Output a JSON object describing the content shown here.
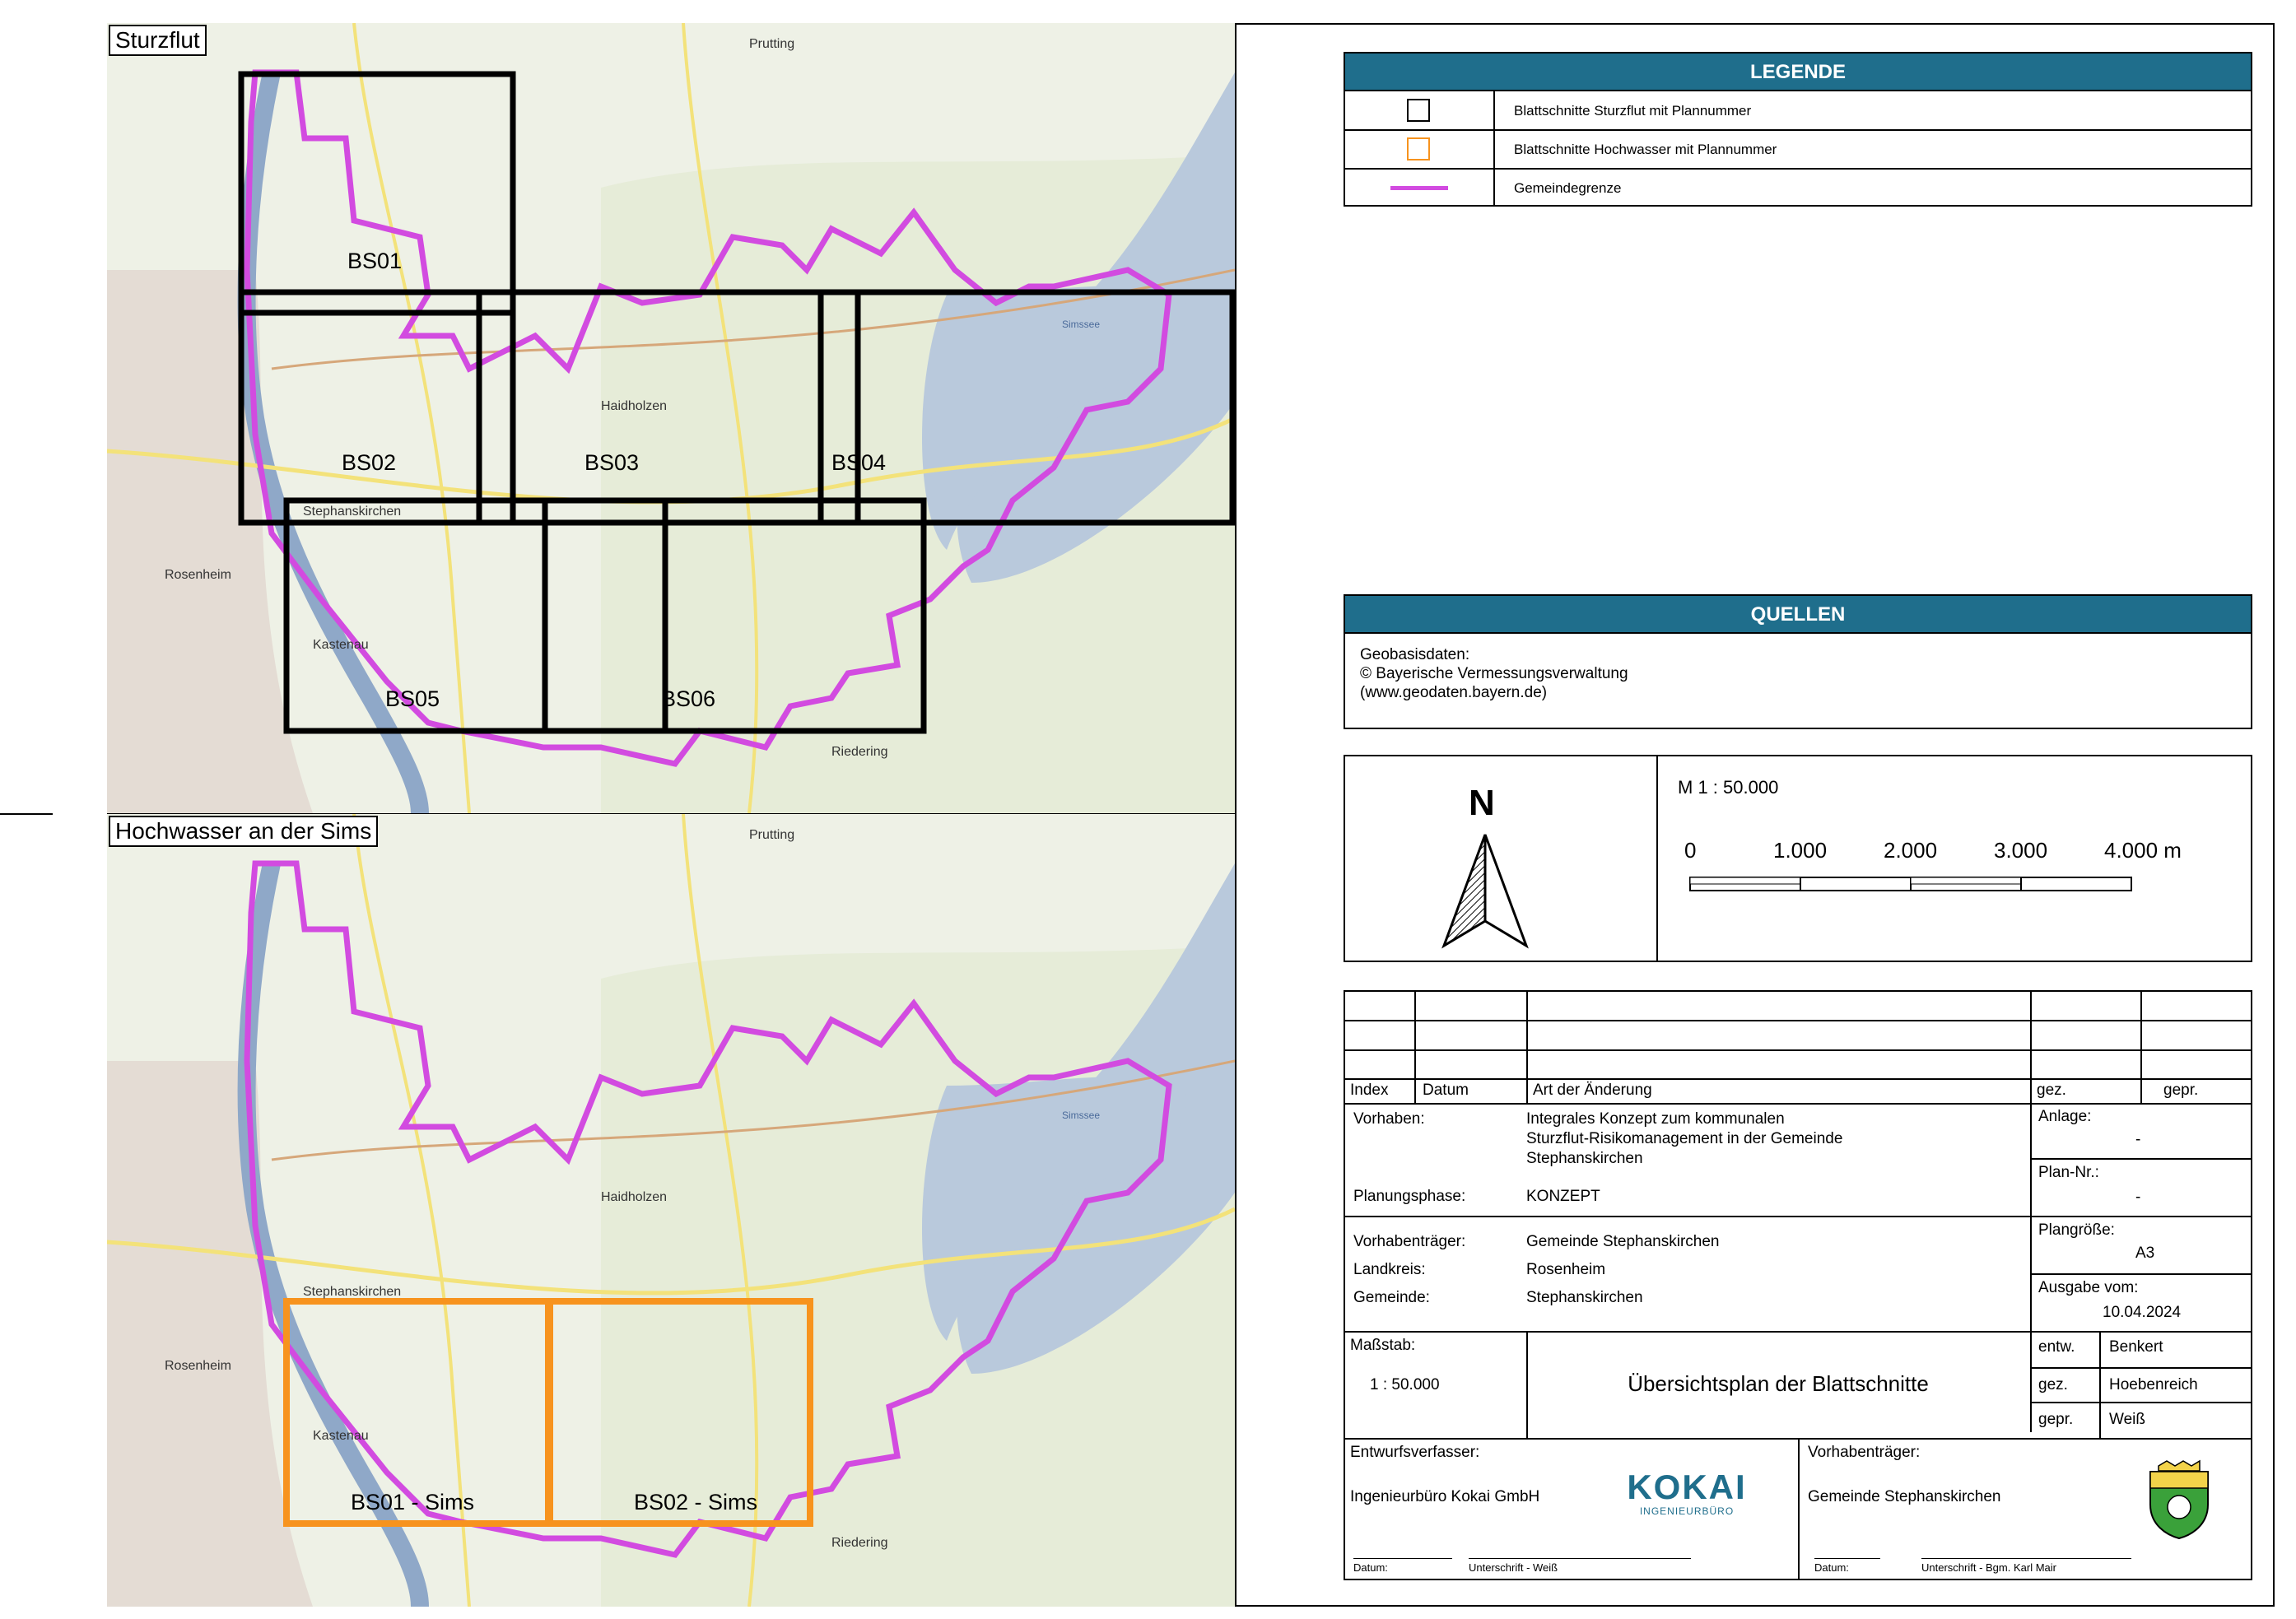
{
  "maps": {
    "top": {
      "label": "Sturzflut",
      "sheets": [
        {
          "name": "BS01"
        },
        {
          "name": "BS02"
        },
        {
          "name": "BS03"
        },
        {
          "name": "BS04"
        },
        {
          "name": "BS05"
        },
        {
          "name": "BS06"
        }
      ],
      "places": [
        "Prutting",
        "Rosenheim",
        "Kastenau",
        "Riedering",
        "Stephanskirchen",
        "Haidholzen",
        "Simssee"
      ]
    },
    "bottom": {
      "label": "Hochwasser an der Sims",
      "sheets": [
        {
          "name": "BS01 - Sims"
        },
        {
          "name": "BS02 - Sims"
        }
      ],
      "places": [
        "Prutting",
        "Rosenheim",
        "Kastenau",
        "Riedering",
        "Stephanskirchen",
        "Haidholzen",
        "Simssee"
      ]
    }
  },
  "legend": {
    "title": "LEGENDE",
    "items": [
      {
        "symbol": "black-square",
        "label": "Blattschnitte Sturzflut mit Plannummer"
      },
      {
        "symbol": "orange-square",
        "label": "Blattschnitte Hochwasser mit Plannummer"
      },
      {
        "symbol": "magenta-line",
        "label": "Gemeindegrenze"
      }
    ]
  },
  "sources": {
    "title": "QUELLEN",
    "lines": [
      "Geobasisdaten:",
      "© Bayerische Vermessungsverwaltung",
      "(www.geodaten.bayern.de)"
    ]
  },
  "scale_box": {
    "north": "N",
    "scale": "M 1 : 50.000",
    "ticks": [
      "0",
      "1.000",
      "2.000",
      "3.000",
      "4.000 m"
    ]
  },
  "title_block": {
    "header": {
      "index": "Index",
      "datum": "Datum",
      "art": "Art der Änderung",
      "gez": "gez.",
      "gepr": "gepr."
    },
    "vorhaben_label": "Vorhaben:",
    "vorhaben_value": [
      "Integrales Konzept zum kommunalen",
      "Sturzflut-Risikomanagement in der Gemeinde",
      "Stephanskirchen"
    ],
    "planungsphase_label": "Planungsphase:",
    "planungsphase_value": "KONZEPT",
    "anlage_label": "Anlage:",
    "anlage_value": "-",
    "plan_nr_label": "Plan-Nr.:",
    "plan_nr_value": "-",
    "vorhabentraeger_label": "Vorhabenträger:",
    "vorhabentraeger_value": "Gemeinde Stephanskirchen",
    "landkreis_label": "Landkreis:",
    "landkreis_value": "Rosenheim",
    "gemeinde_label": "Gemeinde:",
    "gemeinde_value": "Stephanskirchen",
    "plangroesse_label": "Plangröße:",
    "plangroesse_value": "A3",
    "ausgabe_label": "Ausgabe vom:",
    "ausgabe_value": "10.04.2024",
    "massstab_label": "Maßstab:",
    "massstab_value": "1 : 50.000",
    "plan_title": "Übersichtsplan der Blattschnitte",
    "entw_label": "entw.",
    "entw_value": "Benkert",
    "gez_label": "gez.",
    "gez_value": "Hoebenreich",
    "gepr_label": "gepr.",
    "gepr_value": "Weiß",
    "entwurfsverfasser_label": "Entwurfsverfasser:",
    "entwurfsverfasser_value": "Ingenieurbüro Kokai GmbH",
    "logo_main": "KOKAI",
    "logo_sub": "INGENIEURBÜRO",
    "traeger2_label": "Vorhabenträger:",
    "traeger2_value": "Gemeinde Stephanskirchen",
    "sig1_date": "Datum:",
    "sig1_sign": "Unterschrift - Weiß",
    "sig2_date": "Datum:",
    "sig2_sign": "Unterschrift - Bgm. Karl Mair"
  },
  "colors": {
    "header_blue": "#1f6e8c",
    "boundary": "#d24be0",
    "sturzflut_frame": "#000000",
    "hochwasser_frame": "#f7931e",
    "lake": "#b9c9dc",
    "river": "#8fa8c8"
  }
}
